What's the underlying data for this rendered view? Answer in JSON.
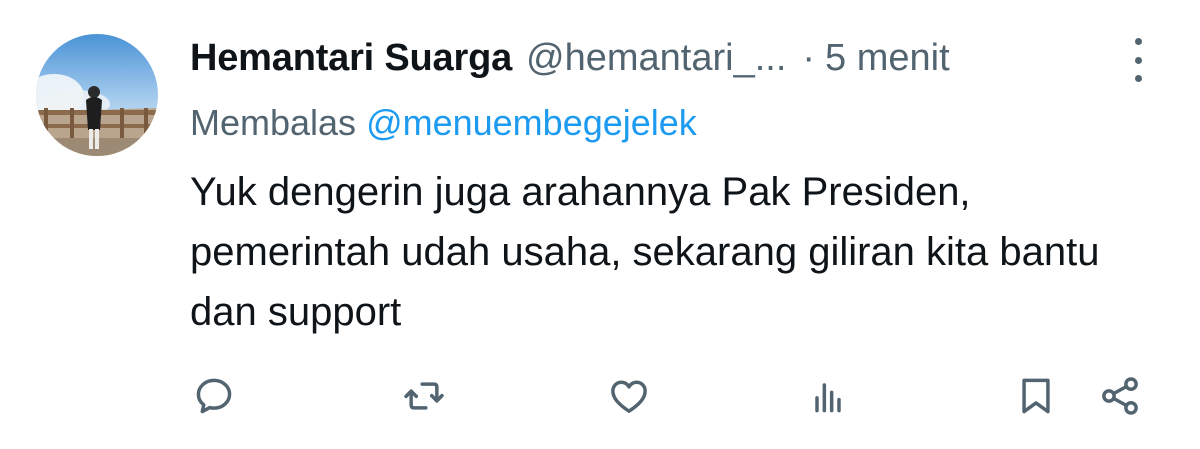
{
  "tweet": {
    "author_name": "Hemantari Suarga",
    "handle": "@hemantari_...",
    "separator": "·",
    "time": "5 menit",
    "reply_prefix": "Membalas",
    "reply_to": "@menuembegejelek",
    "text": "Yuk dengerin juga arahannya Pak Presiden, pemerintah udah usaha, sekarang giliran kita bantu dan support"
  },
  "icons": {
    "more": "more-vertical-icon",
    "reply": "reply-icon",
    "retweet": "retweet-icon",
    "like": "heart-icon",
    "views": "views-icon",
    "bookmark": "bookmark-icon",
    "share": "share-icon"
  },
  "colors": {
    "text": "#0f1419",
    "secondary": "#536471",
    "link": "#1d9bf0",
    "background": "#ffffff"
  }
}
